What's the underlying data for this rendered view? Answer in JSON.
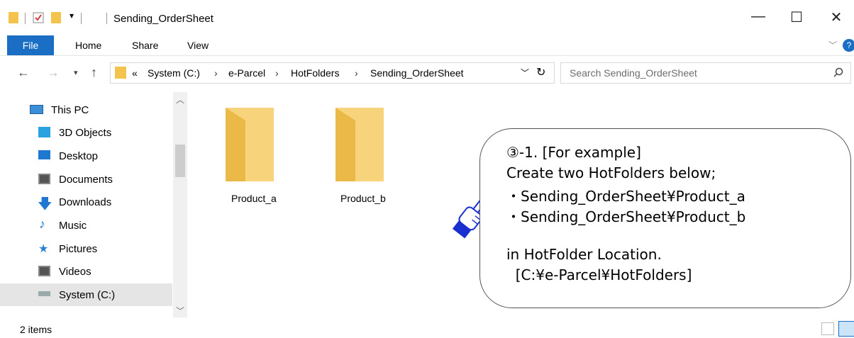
{
  "window": {
    "title": "Sending_OrderSheet",
    "controls": {
      "minimize": "—",
      "maximize": "☐",
      "close": "✕"
    }
  },
  "ribbon": {
    "tabs": [
      {
        "label": "File"
      },
      {
        "label": "Home"
      },
      {
        "label": "Share"
      },
      {
        "label": "View"
      }
    ]
  },
  "address": {
    "overflow": "«",
    "breadcrumbs": [
      "System (C:)",
      "e-Parcel",
      "HotFolders",
      "Sending_OrderSheet"
    ],
    "search_placeholder": "Search Sending_OrderSheet"
  },
  "sidebar": {
    "items": [
      {
        "label": "This PC",
        "icon": "monitor-icon"
      },
      {
        "label": "3D Objects",
        "icon": "cube-icon"
      },
      {
        "label": "Desktop",
        "icon": "desktop-icon"
      },
      {
        "label": "Documents",
        "icon": "documents-icon"
      },
      {
        "label": "Downloads",
        "icon": "download-arrow-icon"
      },
      {
        "label": "Music",
        "icon": "music-note-icon"
      },
      {
        "label": "Pictures",
        "icon": "pictures-icon"
      },
      {
        "label": "Videos",
        "icon": "film-icon"
      },
      {
        "label": "System (C:)",
        "icon": "drive-icon"
      }
    ]
  },
  "content": {
    "folders": [
      {
        "name": "Product_a"
      },
      {
        "name": "Product_b"
      }
    ]
  },
  "callout": {
    "lines": [
      "③-1. [For example]",
      "Create two HotFolders below;",
      "・Sending_OrderSheet¥Product_a",
      "・Sending_OrderSheet¥Product_b",
      "in HotFolder Location.",
      "  [C:¥e-Parcel¥HotFolders]"
    ]
  },
  "status": {
    "items_count": "2 items"
  },
  "colors": {
    "accent": "#1a6ec4",
    "folder": "#f4c34d",
    "selection": "#e5e5e5"
  }
}
